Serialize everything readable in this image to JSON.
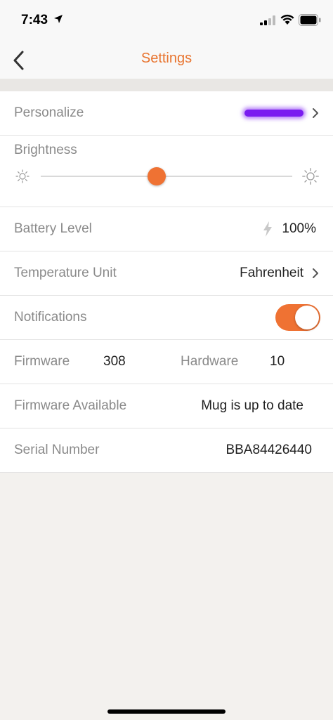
{
  "status_bar": {
    "time": "7:43",
    "icons": [
      "location-arrow-icon",
      "cellular-signal-icon",
      "wifi-icon",
      "battery-icon"
    ]
  },
  "nav": {
    "title": "Settings",
    "back_icon": "chevron-left-icon"
  },
  "colors": {
    "accent": "#ef7233",
    "title": "#e8742f",
    "swatch": "#7a1cf0",
    "label": "#8a8a8a",
    "background": "#f3f1ee"
  },
  "settings": {
    "personalize": {
      "label": "Personalize"
    },
    "brightness": {
      "label": "Brightness",
      "level": 0.46
    },
    "battery": {
      "label": "Battery Level",
      "value": "100%"
    },
    "temperature": {
      "label": "Temperature Unit",
      "value": "Fahrenheit"
    },
    "notifications": {
      "label": "Notifications",
      "enabled": true
    },
    "firmware": {
      "label": "Firmware",
      "value": "308"
    },
    "hardware": {
      "label": "Hardware",
      "value": "10"
    },
    "firmware_available": {
      "label": "Firmware Available",
      "value": "Mug is up to date"
    },
    "serial": {
      "label": "Serial Number",
      "value": "BBA84426440"
    }
  }
}
